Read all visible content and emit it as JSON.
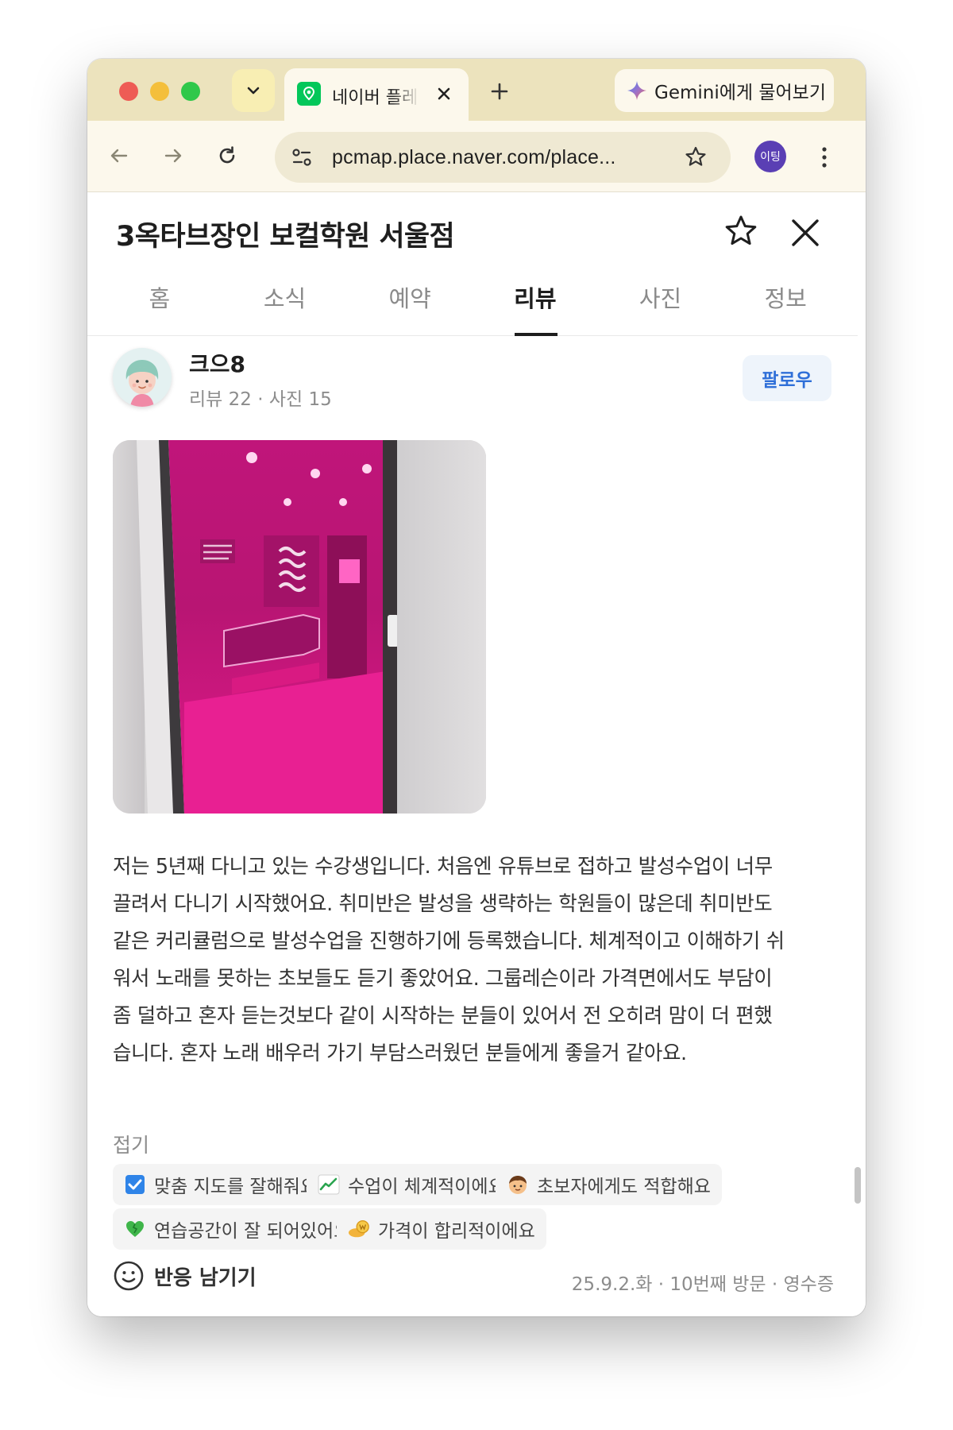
{
  "browser": {
    "tab_title": "네이버 플레이스",
    "gemini_label": "Gemini에게 물어보기",
    "url": "pcmap.place.naver.com/place...",
    "profile_label": "이팅"
  },
  "place": {
    "title": "3옥타브장인 보컬학원 서울점",
    "tabs": [
      "홈",
      "소식",
      "예약",
      "리뷰",
      "사진",
      "정보"
    ],
    "active_tab": "리뷰"
  },
  "review": {
    "nickname": "크으8",
    "meta": "리뷰 22 · 사진 15",
    "follow_label": "팔로우",
    "text_lines": [
      "저는 5년째 다니고 있는 수강생입니다. 처음엔 유튜브로 접하고 발성수업이 너무",
      "끌려서 다니기 시작했어요. 취미반은 발성을 생략하는 학원들이 많은데 취미반도",
      "같은 커리큘럼으로 발성수업을 진행하기에 등록했습니다. 체계적이고 이해하기 쉬",
      "워서 노래를 못하는 초보들도 듣기 좋았어요. 그룹레슨이라 가격면에서도 부담이",
      "좀 덜하고 혼자 듣는것보다 같이 시작하는 분들이 있어서 전 오히려 맘이 더 편했",
      "습니다. 혼자 노래 배우러 가기 부담스러웠던 분들에게 좋을거 같아요."
    ],
    "fold_label": "접기",
    "keywords": [
      {
        "icon": "check-box-icon",
        "label": "맞춤 지도를 잘해줘요"
      },
      {
        "icon": "chart-up-icon",
        "label": "수업이 체계적이에요"
      },
      {
        "icon": "boy-face-icon",
        "label": "초보자에게도 적합해요"
      },
      {
        "icon": "green-heart-icon",
        "label": "연습공간이 잘 되어있어요"
      },
      {
        "icon": "coin-hand-icon",
        "label": "가격이 합리적이에요"
      }
    ],
    "reaction_label": "반응 남기기",
    "visit_info": "25.9.2.화 · 10번째 방문 · 영수증"
  },
  "colors": {
    "tab_strip": "#ece3bd",
    "toolbar": "#fcf8ec",
    "naver_green": "#03c75a",
    "follow_blue": "#2f6fd8",
    "photo_magenta": "#d4177f"
  }
}
